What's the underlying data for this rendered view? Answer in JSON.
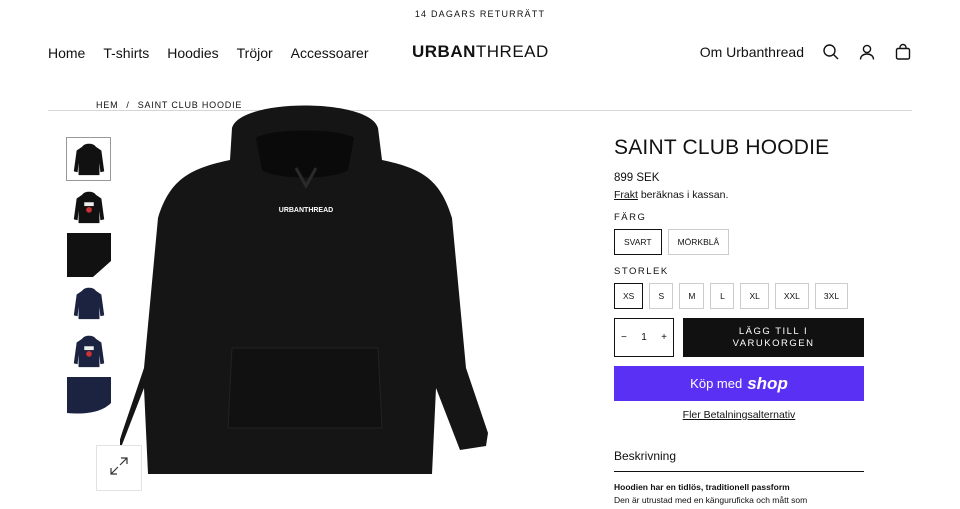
{
  "announcement": "14 DAGARS RETURRÄTT",
  "nav": [
    "Home",
    "T-shirts",
    "Hoodies",
    "Tröjor",
    "Accessoarer"
  ],
  "logo": {
    "bold": "URBAN",
    "light": "THREAD"
  },
  "header_right": {
    "about": "Om Urbanthread",
    "icons": [
      "search-icon",
      "account-icon",
      "cart-icon"
    ]
  },
  "breadcrumb": {
    "home": "HEM",
    "separator": "/",
    "current": "SAINT CLUB HOODIE"
  },
  "gallery": {
    "main_image_logo": "URBANTHREAD",
    "thumbnails": [
      "black-front",
      "black-back-print",
      "black-detail",
      "navy-front",
      "navy-back-print",
      "navy-detail"
    ],
    "colors": {
      "black": "#111111",
      "navy": "#1b2340"
    }
  },
  "product": {
    "title": "SAINT CLUB HOODIE",
    "price": "899 SEK",
    "shipping_link": "Frakt",
    "shipping_text": " beräknas i kassan.",
    "color_label": "FÄRG",
    "colors": [
      "SVART",
      "MÖRKBLÅ"
    ],
    "size_label": "STORLEK",
    "sizes": [
      "XS",
      "S",
      "M",
      "L",
      "XL",
      "XXL",
      "3XL"
    ],
    "quantity": "1",
    "minus": "−",
    "plus": "+",
    "add_to_cart": "LÄGG TILL I VARUKORGEN",
    "shop_pay_prefix": "Köp med",
    "shop_pay_brand": "shop",
    "more_payment": "Fler Betalningsalternativ",
    "description_label": "Beskrivning",
    "description_title": "Hoodien har en tidlös, traditionell passform",
    "description_text": "Den är utrustad med en känguruficka och mått som"
  },
  "accent_color": "#5a31f4"
}
